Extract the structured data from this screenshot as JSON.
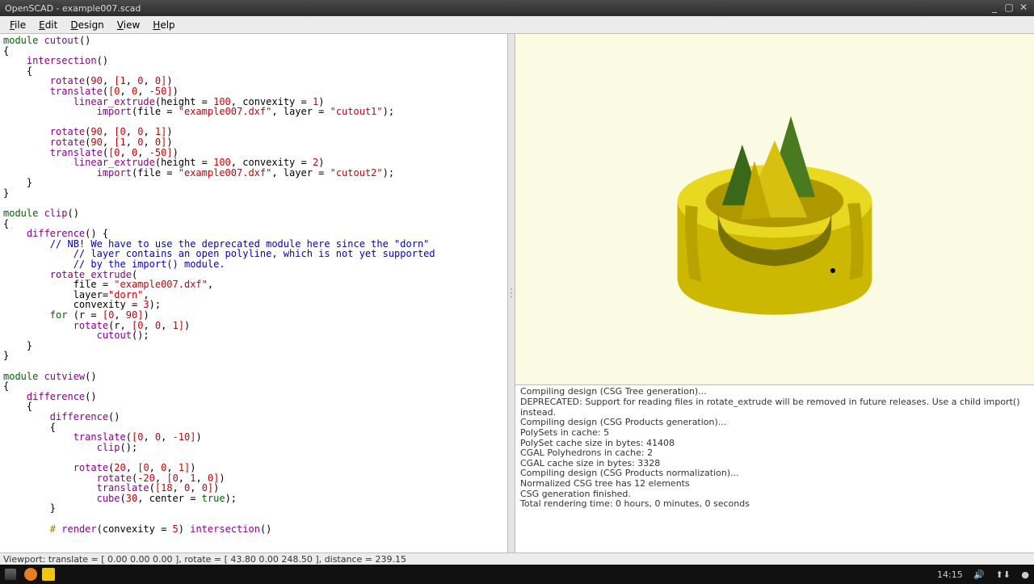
{
  "window": {
    "title": "OpenSCAD - example007.scad"
  },
  "menu": {
    "file": "File",
    "edit": "Edit",
    "design": "Design",
    "view": "View",
    "help": "Help"
  },
  "code": {
    "lines": [
      [
        [
          "kw",
          "module"
        ],
        [
          "",
          ""
        ],
        [
          "fn",
          " cutout"
        ],
        [
          "",
          "()"
        ]
      ],
      [
        [
          "",
          "{"
        ]
      ],
      [
        [
          "",
          "    "
        ],
        [
          "fn",
          "intersection"
        ],
        [
          "",
          "()"
        ]
      ],
      [
        [
          "",
          "    {"
        ]
      ],
      [
        [
          "",
          "        "
        ],
        [
          "fn",
          "rotate"
        ],
        [
          "",
          "("
        ],
        [
          "num",
          "90"
        ],
        [
          "",
          ", "
        ],
        [
          "br",
          "["
        ],
        [
          "num",
          "1"
        ],
        [
          "",
          ", "
        ],
        [
          "num",
          "0"
        ],
        [
          "",
          ", "
        ],
        [
          "num",
          "0"
        ],
        [
          "br",
          "]"
        ],
        [
          "",
          ")"
        ]
      ],
      [
        [
          "",
          "        "
        ],
        [
          "fn",
          "translate"
        ],
        [
          "",
          "("
        ],
        [
          "br",
          "["
        ],
        [
          "num",
          "0"
        ],
        [
          "",
          ", "
        ],
        [
          "num",
          "0"
        ],
        [
          "",
          ", "
        ],
        [
          "num",
          "-50"
        ],
        [
          "br",
          "]"
        ],
        [
          "",
          ")"
        ]
      ],
      [
        [
          "",
          "            "
        ],
        [
          "fn",
          "linear_extrude"
        ],
        [
          "",
          "(height = "
        ],
        [
          "num",
          "100"
        ],
        [
          "",
          ", convexity = "
        ],
        [
          "num",
          "1"
        ],
        [
          "",
          ")"
        ]
      ],
      [
        [
          "",
          "                "
        ],
        [
          "fn",
          "import"
        ],
        [
          "",
          "(file = "
        ],
        [
          "str",
          "\"example007.dxf\""
        ],
        [
          "",
          ", layer = "
        ],
        [
          "str",
          "\"cutout1\""
        ],
        [
          "",
          ");"
        ]
      ],
      [
        [
          "",
          ""
        ]
      ],
      [
        [
          "",
          "        "
        ],
        [
          "fn",
          "rotate"
        ],
        [
          "",
          "("
        ],
        [
          "num",
          "90"
        ],
        [
          "",
          ", "
        ],
        [
          "br",
          "["
        ],
        [
          "num",
          "0"
        ],
        [
          "",
          ", "
        ],
        [
          "num",
          "0"
        ],
        [
          "",
          ", "
        ],
        [
          "num",
          "1"
        ],
        [
          "br",
          "]"
        ],
        [
          "",
          ")"
        ]
      ],
      [
        [
          "",
          "        "
        ],
        [
          "fn",
          "rotate"
        ],
        [
          "",
          "("
        ],
        [
          "num",
          "90"
        ],
        [
          "",
          ", "
        ],
        [
          "br",
          "["
        ],
        [
          "num",
          "1"
        ],
        [
          "",
          ", "
        ],
        [
          "num",
          "0"
        ],
        [
          "",
          ", "
        ],
        [
          "num",
          "0"
        ],
        [
          "br",
          "]"
        ],
        [
          "",
          ")"
        ]
      ],
      [
        [
          "",
          "        "
        ],
        [
          "fn",
          "translate"
        ],
        [
          "",
          "("
        ],
        [
          "br",
          "["
        ],
        [
          "num",
          "0"
        ],
        [
          "",
          ", "
        ],
        [
          "num",
          "0"
        ],
        [
          "",
          ", "
        ],
        [
          "num",
          "-50"
        ],
        [
          "br",
          "]"
        ],
        [
          "",
          ")"
        ]
      ],
      [
        [
          "",
          "            "
        ],
        [
          "fn",
          "linear_extrude"
        ],
        [
          "",
          "(height = "
        ],
        [
          "num",
          "100"
        ],
        [
          "",
          ", convexity = "
        ],
        [
          "num",
          "2"
        ],
        [
          "",
          ")"
        ]
      ],
      [
        [
          "",
          "                "
        ],
        [
          "fn",
          "import"
        ],
        [
          "",
          "(file = "
        ],
        [
          "str",
          "\"example007.dxf\""
        ],
        [
          "",
          ", layer = "
        ],
        [
          "str",
          "\"cutout2\""
        ],
        [
          "",
          ");"
        ]
      ],
      [
        [
          "",
          "    }"
        ]
      ],
      [
        [
          "",
          "}"
        ]
      ],
      [
        [
          "",
          ""
        ]
      ],
      [
        [
          "kw",
          "module"
        ],
        [
          "fn",
          " clip"
        ],
        [
          "",
          "()"
        ]
      ],
      [
        [
          "",
          "{"
        ]
      ],
      [
        [
          "",
          "    "
        ],
        [
          "fn",
          "difference"
        ],
        [
          "",
          "() {"
        ]
      ],
      [
        [
          "",
          "        "
        ],
        [
          "cm",
          "// NB! We have to use the deprecated module here since the \"dorn\""
        ]
      ],
      [
        [
          "",
          "            "
        ],
        [
          "cm",
          "// layer contains an open polyline, which is not yet supported"
        ]
      ],
      [
        [
          "",
          "            "
        ],
        [
          "cm",
          "// by the import() module."
        ]
      ],
      [
        [
          "",
          "        "
        ],
        [
          "fn",
          "rotate_extrude"
        ],
        [
          "",
          "("
        ]
      ],
      [
        [
          "",
          "            file = "
        ],
        [
          "str",
          "\"example007.dxf\""
        ],
        [
          "",
          ","
        ]
      ],
      [
        [
          "",
          "            layer="
        ],
        [
          "str",
          "\"dorn\""
        ],
        [
          "",
          ","
        ]
      ],
      [
        [
          "",
          "            convexity = "
        ],
        [
          "num",
          "3"
        ],
        [
          "",
          ");"
        ]
      ],
      [
        [
          "",
          "        "
        ],
        [
          "kw",
          "for"
        ],
        [
          "",
          " (r = "
        ],
        [
          "br",
          "["
        ],
        [
          "num",
          "0"
        ],
        [
          "",
          ", "
        ],
        [
          "num",
          "90"
        ],
        [
          "br",
          "]"
        ],
        [
          "",
          ")"
        ]
      ],
      [
        [
          "",
          "            "
        ],
        [
          "fn",
          "rotate"
        ],
        [
          "",
          "(r, "
        ],
        [
          "br",
          "["
        ],
        [
          "num",
          "0"
        ],
        [
          "",
          ", "
        ],
        [
          "num",
          "0"
        ],
        [
          "",
          ", "
        ],
        [
          "num",
          "1"
        ],
        [
          "br",
          "]"
        ],
        [
          "",
          ")"
        ]
      ],
      [
        [
          "",
          "                "
        ],
        [
          "fn",
          "cutout"
        ],
        [
          "",
          "();"
        ]
      ],
      [
        [
          "",
          "    }"
        ]
      ],
      [
        [
          "",
          "}"
        ]
      ],
      [
        [
          "",
          ""
        ]
      ],
      [
        [
          "kw",
          "module"
        ],
        [
          "fn",
          " cutview"
        ],
        [
          "",
          "()"
        ]
      ],
      [
        [
          "",
          "{"
        ]
      ],
      [
        [
          "",
          "    "
        ],
        [
          "fn",
          "difference"
        ],
        [
          "",
          "()"
        ]
      ],
      [
        [
          "",
          "    {"
        ]
      ],
      [
        [
          "",
          "        "
        ],
        [
          "fn",
          "difference"
        ],
        [
          "",
          "()"
        ]
      ],
      [
        [
          "",
          "        {"
        ]
      ],
      [
        [
          "",
          "            "
        ],
        [
          "fn",
          "translate"
        ],
        [
          "",
          "("
        ],
        [
          "br",
          "["
        ],
        [
          "num",
          "0"
        ],
        [
          "",
          ", "
        ],
        [
          "num",
          "0"
        ],
        [
          "",
          ", "
        ],
        [
          "num",
          "-10"
        ],
        [
          "br",
          "]"
        ],
        [
          "",
          ")"
        ]
      ],
      [
        [
          "",
          "                "
        ],
        [
          "fn",
          "clip"
        ],
        [
          "",
          "();"
        ]
      ],
      [
        [
          "",
          ""
        ]
      ],
      [
        [
          "",
          "            "
        ],
        [
          "fn",
          "rotate"
        ],
        [
          "",
          "("
        ],
        [
          "num",
          "20"
        ],
        [
          "",
          ", "
        ],
        [
          "br",
          "["
        ],
        [
          "num",
          "0"
        ],
        [
          "",
          ", "
        ],
        [
          "num",
          "0"
        ],
        [
          "",
          ", "
        ],
        [
          "num",
          "1"
        ],
        [
          "br",
          "]"
        ],
        [
          "",
          ")"
        ]
      ],
      [
        [
          "",
          "                "
        ],
        [
          "fn",
          "rotate"
        ],
        [
          "",
          "("
        ],
        [
          "num",
          "-20"
        ],
        [
          "",
          ", "
        ],
        [
          "br",
          "["
        ],
        [
          "num",
          "0"
        ],
        [
          "",
          ", "
        ],
        [
          "num",
          "1"
        ],
        [
          "",
          ", "
        ],
        [
          "num",
          "0"
        ],
        [
          "br",
          "]"
        ],
        [
          "",
          ")"
        ]
      ],
      [
        [
          "",
          "                "
        ],
        [
          "fn",
          "translate"
        ],
        [
          "",
          "("
        ],
        [
          "br",
          "["
        ],
        [
          "num",
          "18"
        ],
        [
          "",
          ", "
        ],
        [
          "num",
          "0"
        ],
        [
          "",
          ", "
        ],
        [
          "num",
          "0"
        ],
        [
          "br",
          "]"
        ],
        [
          "",
          ")"
        ]
      ],
      [
        [
          "",
          "                "
        ],
        [
          "fn",
          "cube"
        ],
        [
          "",
          "("
        ],
        [
          "num",
          "30"
        ],
        [
          "",
          ", center = "
        ],
        [
          "kw",
          "true"
        ],
        [
          "",
          ");"
        ]
      ],
      [
        [
          "",
          "        }"
        ]
      ],
      [
        [
          "",
          ""
        ]
      ],
      [
        [
          "",
          "        "
        ],
        [
          "hl",
          "#"
        ],
        [
          "",
          " "
        ],
        [
          "fn",
          "render"
        ],
        [
          "",
          "(convexity = "
        ],
        [
          "num",
          "5"
        ],
        [
          "",
          ") "
        ],
        [
          "fn",
          "intersection"
        ],
        [
          "",
          "()"
        ]
      ]
    ]
  },
  "console": {
    "lines": [
      "Compiling design (CSG Tree generation)...",
      "DEPRECATED: Support for reading files in rotate_extrude will be removed in future releases. Use a child import() instead.",
      "Compiling design (CSG Products generation)...",
      "PolySets in cache: 5",
      "PolySet cache size in bytes: 41408",
      "CGAL Polyhedrons in cache: 2",
      "CGAL cache size in bytes: 3328",
      "Compiling design (CSG Products normalization)...",
      "Normalized CSG tree has 12 elements",
      "CSG generation finished.",
      "Total rendering time: 0 hours, 0 minutes, 0 seconds"
    ]
  },
  "status": {
    "text": "Viewport: translate = [ 0.00 0.00 0.00 ], rotate = [ 43.80 0.00 248.50 ], distance = 239.15"
  },
  "taskbar": {
    "time": "14:15"
  }
}
